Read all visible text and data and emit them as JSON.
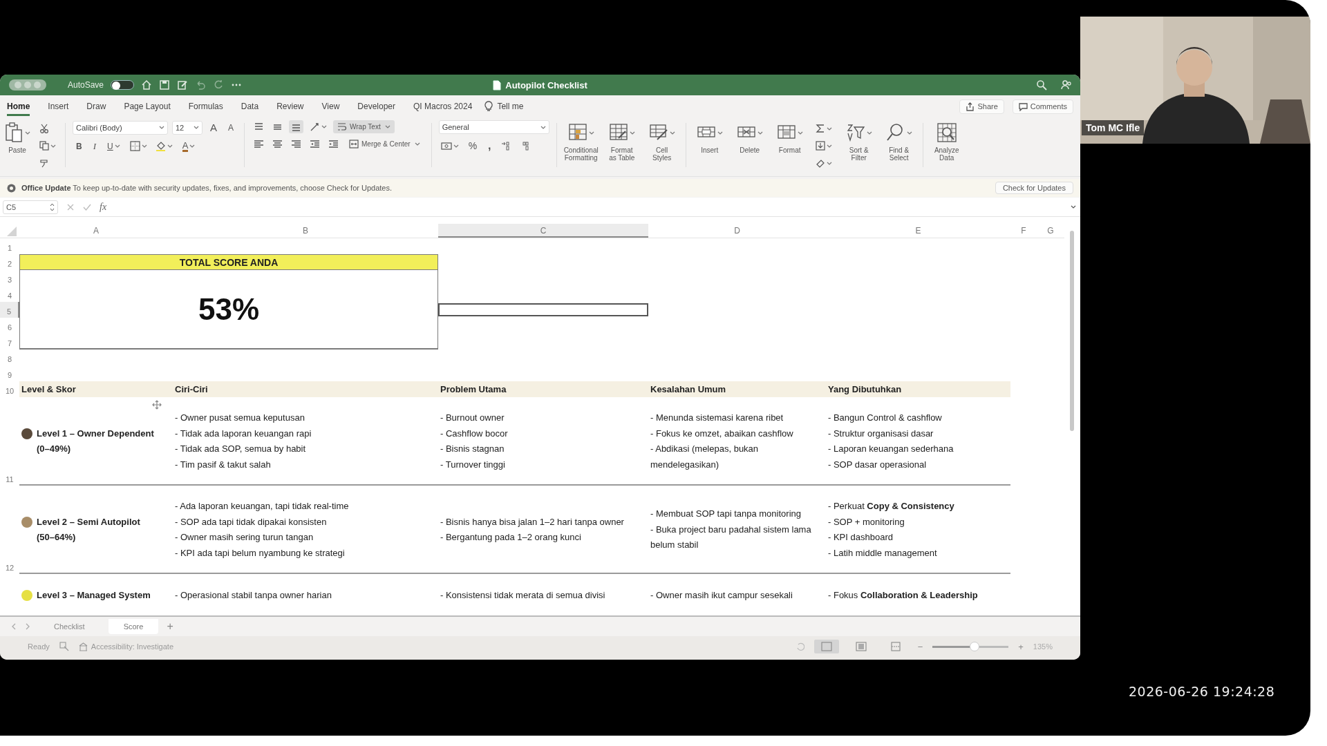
{
  "window": {
    "title": "Autopilot Checklist",
    "autosave": {
      "label": "AutoSave",
      "on": false
    }
  },
  "ribbon_tabs": [
    {
      "label": "Home",
      "selected": true
    },
    {
      "label": "Insert",
      "selected": false
    },
    {
      "label": "Draw",
      "selected": false
    },
    {
      "label": "Page Layout",
      "selected": false
    },
    {
      "label": "Formulas",
      "selected": false
    },
    {
      "label": "Data",
      "selected": false
    },
    {
      "label": "Review",
      "selected": false
    },
    {
      "label": "View",
      "selected": false
    },
    {
      "label": "Developer",
      "selected": false
    },
    {
      "label": "QI Macros 2024",
      "selected": false
    }
  ],
  "tell_me": "Tell me",
  "share": "Share",
  "comments": "Comments",
  "ribbon": {
    "paste": "Paste",
    "font_name": "Calibri (Body)",
    "font_size": "12",
    "grow": "A",
    "shrink": "A",
    "bold": "B",
    "italic": "I",
    "underline": "U",
    "font_color": "A",
    "wrap_text": {
      "label": "Wrap Text",
      "on": true
    },
    "merge": "Merge & Center",
    "number_format": "General",
    "percent": "%",
    "comma": ",",
    "large_buttons": [
      {
        "label": "Conditional\nFormatting",
        "kind": "conditional"
      },
      {
        "label": "Format\nas Table",
        "kind": "table"
      },
      {
        "label": "Cell\nStyles",
        "kind": "styles"
      },
      {
        "label": "Insert",
        "kind": "insert"
      },
      {
        "label": "Delete",
        "kind": "delete"
      },
      {
        "label": "Format",
        "kind": "format"
      },
      {
        "label": "Sort &\nFilter",
        "kind": "sort"
      },
      {
        "label": "Find &\nSelect",
        "kind": "find"
      },
      {
        "label": "Analyze\nData",
        "kind": "analyze"
      }
    ]
  },
  "update_bar": {
    "title": "Office Update",
    "message": "To keep up-to-date with security updates, fixes, and improvements, choose Check for Updates.",
    "button": "Check for Updates"
  },
  "formula_bar": {
    "name_box": "C5",
    "fx": "fx"
  },
  "sheet": {
    "columns": [
      {
        "label": "A",
        "selected": false
      },
      {
        "label": "B",
        "selected": false
      },
      {
        "label": "C",
        "selected": true
      },
      {
        "label": "D",
        "selected": false
      },
      {
        "label": "E",
        "selected": false
      },
      {
        "label": "F",
        "selected": false
      },
      {
        "label": "G",
        "selected": false
      }
    ],
    "rows": [
      {
        "label": "1",
        "selected": false
      },
      {
        "label": "2",
        "selected": false
      },
      {
        "label": "3",
        "selected": false
      },
      {
        "label": "4",
        "selected": false
      },
      {
        "label": "5",
        "selected": true
      },
      {
        "label": "6",
        "selected": false
      },
      {
        "label": "7",
        "selected": false
      },
      {
        "label": "8",
        "selected": false
      },
      {
        "label": "9",
        "selected": false
      },
      {
        "label": "10",
        "selected": false
      },
      {
        "label": "11",
        "selected": false
      },
      {
        "label": "12",
        "selected": false
      }
    ],
    "score_card": {
      "title": "TOTAL SCORE ANDA",
      "value": "53%"
    },
    "table": {
      "columns": [
        "Level & Skor",
        "Ciri-Ciri",
        "Problem Utama",
        "Kesalahan Umum",
        "Yang Dibutuhkan"
      ],
      "rows": [
        {
          "color": "#5a4a3b",
          "cells": [
            "Level 1 – Owner Dependent\n(0–49%)",
            "- Owner pusat semua keputusan\n- Tidak ada laporan keuangan rapi\n- Tidak ada SOP, semua by habit\n- Tim pasif & takut salah",
            "- Burnout owner\n- Cashflow bocor\n- Bisnis stagnan\n- Turnover tinggi",
            "- Menunda sistemasi karena ribet\n- Fokus ke omzet, abaikan cashflow\n- Abdikasi (melepas, bukan mendelegasikan)",
            "- Bangun Control & cashflow\n- Struktur organisasi dasar\n- Laporan keuangan sederhana\n- SOP dasar operasional"
          ]
        },
        {
          "color": "#a88d68",
          "cells": [
            "Level 2 – Semi Autopilot\n(50–64%)",
            "- Ada laporan keuangan, tapi tidak real-time\n- SOP ada tapi tidak dipakai konsisten\n- Owner masih sering turun tangan\n- KPI ada tapi belum nyambung ke strategi",
            "- Bisnis hanya bisa jalan 1–2 hari tanpa owner\n- Bergantung pada 1–2 orang kunci",
            "- Membuat SOP tapi tanpa monitoring\n- Buka project baru padahal sistem lama belum stabil",
            "- Perkuat **Copy & Consistency**\n- SOP + monitoring\n- KPI dashboard\n- Latih middle management"
          ]
        },
        {
          "color": "#e6e044",
          "cells": [
            "Level 3 – Managed System",
            "- Operasional stabil tanpa owner harian",
            "- Konsistensi tidak merata di semua divisi",
            "- Owner masih ikut campur sesekali",
            "- Fokus **Collaboration & Leadership**"
          ]
        }
      ]
    }
  },
  "sheet_tabs": [
    {
      "label": "Checklist",
      "selected": false
    },
    {
      "label": "Score",
      "selected": true
    }
  ],
  "add_sheet": "+",
  "status_bar": {
    "state": "Ready",
    "accessibility": "Accessibility: Investigate",
    "views": [
      {
        "kind": "normal",
        "selected": true
      },
      {
        "kind": "page-layout",
        "selected": false
      },
      {
        "kind": "page-break",
        "selected": false
      }
    ],
    "zoom_out": "−",
    "zoom_in": "+",
    "zoom": {
      "level": 0.55
    },
    "zoom_text": "135%"
  },
  "video": {
    "participant": "Tom MC Ifle",
    "timestamp": "2026-06-26 19:24:28"
  }
}
